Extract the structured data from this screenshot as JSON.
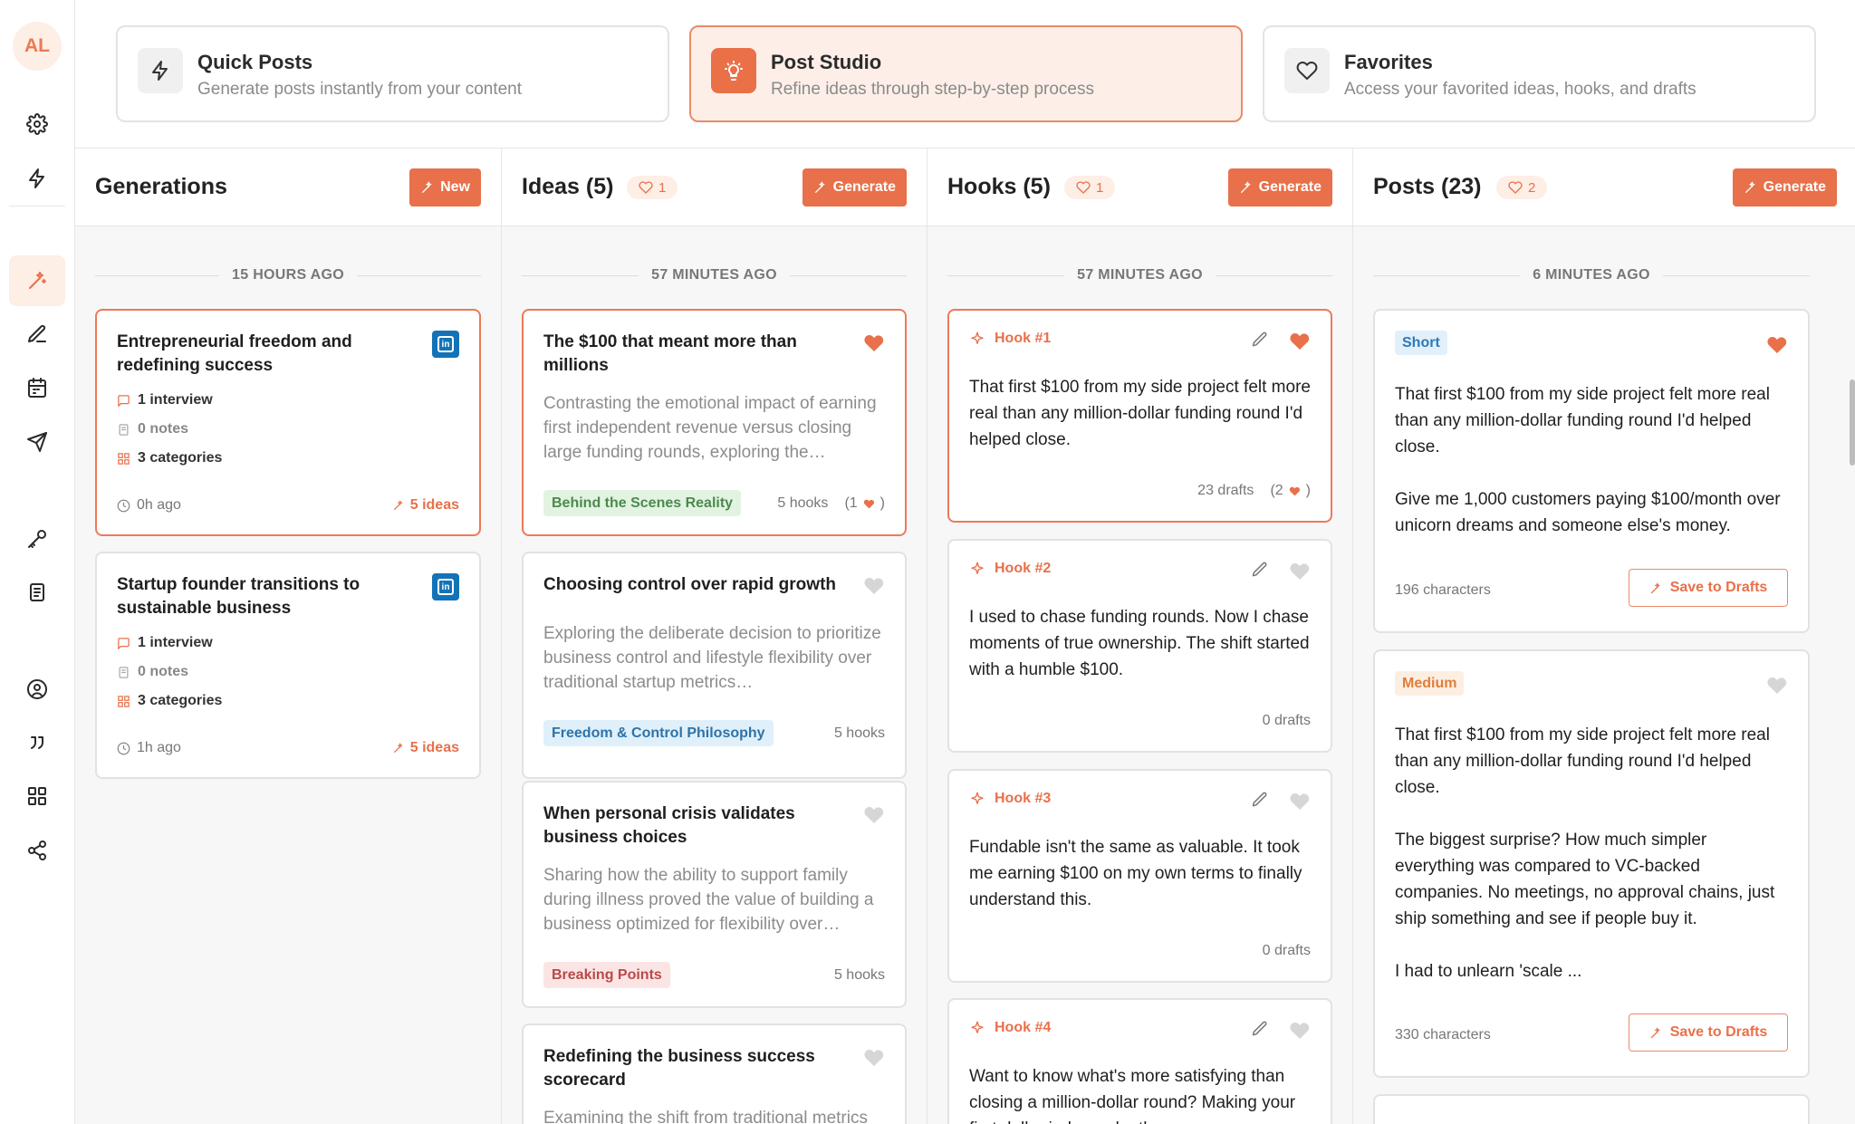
{
  "user": {
    "initials": "AL"
  },
  "modes": [
    {
      "title": "Quick Posts",
      "subtitle": "Generate posts instantly from your content",
      "icon": "bolt-icon"
    },
    {
      "title": "Post Studio",
      "subtitle": "Refine ideas through step-by-step process",
      "icon": "lightbulb-icon"
    },
    {
      "title": "Favorites",
      "subtitle": "Access your favorited ideas, hooks, and drafts",
      "icon": "heart-icon"
    }
  ],
  "accent_color": "#e8704a",
  "generations": {
    "title": "Generations",
    "new_label": "New",
    "time_label": "15 HOURS AGO",
    "items": [
      {
        "title": "Entrepreneurial freedom and redefining success",
        "interviews": "1 interview",
        "notes": "0 notes",
        "categories": "3 categories",
        "ago": "0h ago",
        "ideas": "5 ideas"
      },
      {
        "title": "Startup founder transitions to sustainable business",
        "interviews": "1 interview",
        "notes": "0 notes",
        "categories": "3 categories",
        "ago": "1h ago",
        "ideas": "5 ideas"
      }
    ]
  },
  "ideas": {
    "title": "Ideas (5)",
    "fav_count": "1",
    "generate_label": "Generate",
    "time_label": "57 MINUTES AGO",
    "items": [
      {
        "title": "The $100 that meant more than millions",
        "desc": "Contrasting the emotional impact of earning first independent revenue versus closing large funding rounds, exploring the…",
        "tag": "Behind the Scenes Reality",
        "hooks": "5 hooks",
        "fav_hooks_open": "(1",
        "fav_hooks_close": ")",
        "favorited": true
      },
      {
        "title": "Choosing control over rapid growth",
        "desc": "Exploring the deliberate decision to prioritize business control and lifestyle flexibility over traditional startup metrics…",
        "tag": "Freedom & Control Philosophy",
        "hooks": "5 hooks",
        "favorited": false
      },
      {
        "title": "When personal crisis validates business choices",
        "desc": "Sharing how the ability to support family during illness proved the value of building a business optimized for flexibility over…",
        "tag": "Breaking Points",
        "hooks": "5 hooks",
        "favorited": false
      },
      {
        "title": "Redefining the business success scorecard",
        "desc": "Examining the shift from traditional metrics",
        "favorited": false
      }
    ]
  },
  "hooks": {
    "title": "Hooks (5)",
    "fav_count": "1",
    "generate_label": "Generate",
    "time_label": "57 MINUTES AGO",
    "items": [
      {
        "label": "Hook #1",
        "text": "That first $100 from my side project felt more real than any million-dollar funding round I'd helped close.",
        "drafts": "23 drafts",
        "fav_open": "(2",
        "fav_close": ")",
        "favorited": true
      },
      {
        "label": "Hook #2",
        "text": "I used to chase funding rounds. Now I chase moments of true ownership. The shift started with a humble $100.",
        "drafts": "0 drafts",
        "favorited": false
      },
      {
        "label": "Hook #3",
        "text": "Fundable isn't the same as valuable. It took me earning $100 on my own terms to finally understand this.",
        "drafts": "0 drafts",
        "favorited": false
      },
      {
        "label": "Hook #4",
        "text": "Want to know what's more satisfying than closing a million-dollar round? Making your first dollar independently.",
        "favorited": false
      }
    ]
  },
  "posts": {
    "title": "Posts (23)",
    "fav_count": "2",
    "generate_label": "Generate",
    "time_label": "6 MINUTES AGO",
    "items": [
      {
        "length": "Short",
        "text": "That first $100 from my side project felt more real than any million-dollar funding round I'd helped close.\n\nGive me 1,000 customers paying $100/month over unicorn dreams and someone else's money.",
        "chars": "196 characters",
        "save_label": "Save to Drafts",
        "favorited": true
      },
      {
        "length": "Medium",
        "text": "That first $100 from my side project felt more real than any million-dollar funding round I'd helped close.\n\nThe biggest surprise? How much simpler everything was compared to VC-backed companies. No meetings, no approval chains, just ship something and see if people buy it.\n\nI had to unlearn 'scale ...",
        "chars": "330 characters",
        "save_label": "Save to Drafts",
        "favorited": false
      }
    ]
  }
}
